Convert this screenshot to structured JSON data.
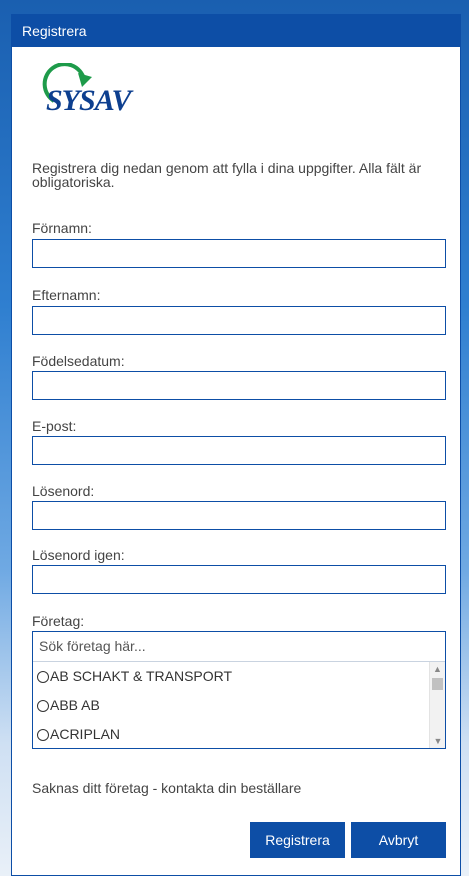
{
  "dialog": {
    "title": "Registrera"
  },
  "logo": {
    "text": "SYSAV",
    "arrow_color": "#1e9b4a",
    "text_color": "#0d3f8f"
  },
  "intro": "Registrera dig nedan genom att fylla i dina uppgifter. Alla fält är obligatoriska.",
  "fields": [
    {
      "label": "Förnamn:",
      "value": ""
    },
    {
      "label": "Efternamn:",
      "value": ""
    },
    {
      "label": "Födelsedatum:",
      "value": ""
    },
    {
      "label": "E-post:",
      "value": ""
    },
    {
      "label": "Lösenord:",
      "value": ""
    },
    {
      "label": "Lösenord igen:",
      "value": ""
    }
  ],
  "company": {
    "label": "Företag:",
    "search_placeholder": "Sök företag här...",
    "options": [
      "AB SCHAKT & TRANSPORT",
      "ABB AB",
      "ACRIPLAN"
    ]
  },
  "missing_company_text": "Saknas ditt företag - kontakta din beställare",
  "buttons": {
    "register": "Registrera",
    "cancel": "Avbryt"
  },
  "colors": {
    "primary": "#0d4ea6"
  }
}
